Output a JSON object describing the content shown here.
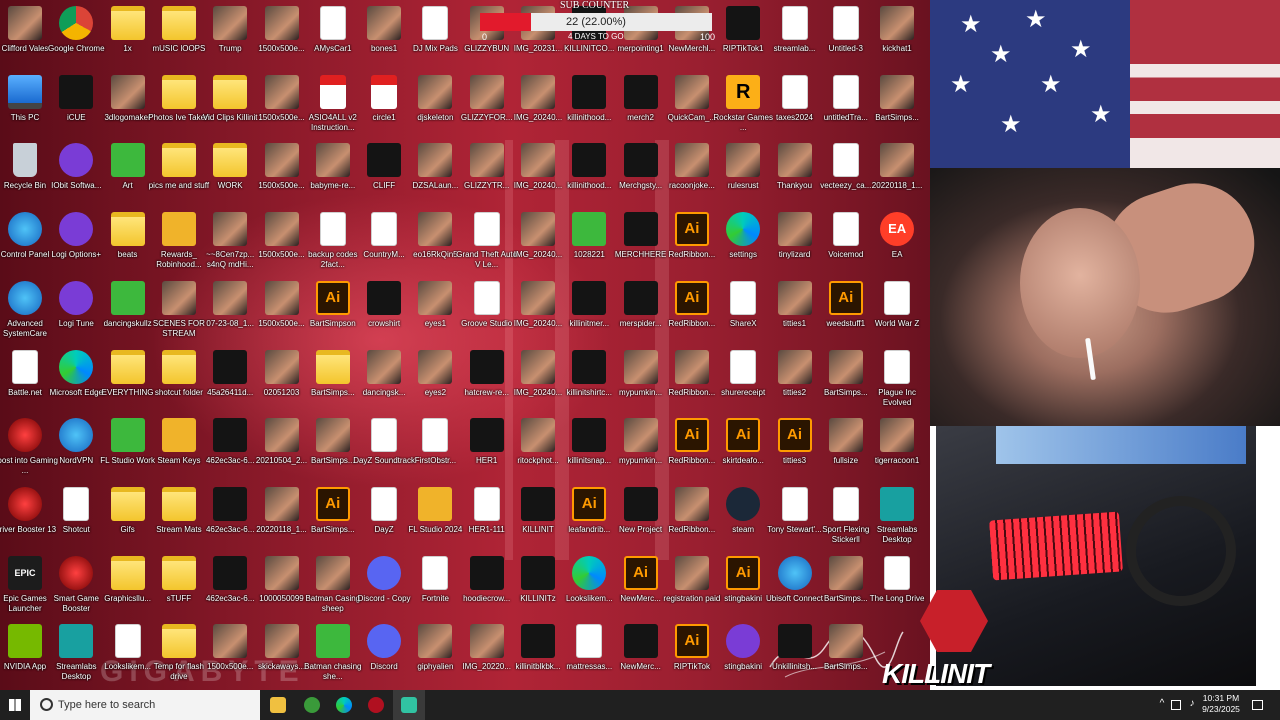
{
  "desktop": {
    "icons": [
      [
        "Clifford Vales",
        "img"
      ],
      [
        "Google Chrome",
        "chrome"
      ],
      [
        "1x",
        "folder"
      ],
      [
        "mUSIC lOOPS",
        "folder"
      ],
      [
        "Trump",
        "img"
      ],
      [
        "1500x500e...",
        "img"
      ],
      [
        "AMysCar1",
        "doc"
      ],
      [
        "bones1",
        "img"
      ],
      [
        "DJ Mix Pads",
        "doc"
      ],
      [
        "GLIZZYBUN",
        "img"
      ],
      [
        "IMG_20231...",
        "img"
      ],
      [
        "KILLINITCO...",
        "dark"
      ],
      [
        "merpointing1",
        "img"
      ],
      [
        "NewMerchl...",
        "img"
      ],
      [
        "RIPTikTok1",
        "dark"
      ],
      [
        "streamlab...",
        "doc"
      ],
      [
        "Untitled-3",
        "doc"
      ],
      [
        "kickhat1",
        "img"
      ],
      [
        "New",
        "doc"
      ],
      [
        "This PC",
        "pc"
      ],
      [
        "iCUE",
        "dark"
      ],
      [
        "3dlogomaker",
        "img"
      ],
      [
        "Photos Ive Taken",
        "folder"
      ],
      [
        "Vid Clips Killinit",
        "folder"
      ],
      [
        "1500x500e...",
        "img"
      ],
      [
        "ASIO4ALL v2 Instruction...",
        "pdf"
      ],
      [
        "circle1",
        "pdf"
      ],
      [
        "djskeleton",
        "img"
      ],
      [
        "GLIZZYFOR...",
        "img"
      ],
      [
        "IMG_20240...",
        "img"
      ],
      [
        "killinithood...",
        "dark"
      ],
      [
        "merch2",
        "dark"
      ],
      [
        "QuickCam_...",
        "img"
      ],
      [
        "Rockstar Games ...",
        "r"
      ],
      [
        "taxes2024",
        "doc"
      ],
      [
        "untitledTra...",
        "doc"
      ],
      [
        "BartSimps...",
        "img"
      ],
      [
        "Recycle Bin",
        "bin"
      ],
      [
        "IObit Softwa...",
        "purple"
      ],
      [
        "Art",
        "green"
      ],
      [
        "pics me and stuff",
        "folder"
      ],
      [
        "WORK",
        "folder"
      ],
      [
        "1500x500e...",
        "img"
      ],
      [
        "babyme-re...",
        "img"
      ],
      [
        "CLIFF",
        "dark"
      ],
      [
        "DZSALaun...",
        "img"
      ],
      [
        "GLIZZYTR...",
        "img"
      ],
      [
        "IMG_20240...",
        "img"
      ],
      [
        "killinithood...",
        "dark"
      ],
      [
        "Merchgsty...",
        "dark"
      ],
      [
        "racoonjoke...",
        "img"
      ],
      [
        "rulesrust",
        "img"
      ],
      [
        "Thankyou",
        "img"
      ],
      [
        "vecteezy_ca...",
        "doc"
      ],
      [
        "20220118_1...",
        "img"
      ],
      [
        "Control Panel",
        "app"
      ],
      [
        "Logi Options+",
        "purple"
      ],
      [
        "beats",
        "folder"
      ],
      [
        "Rewards_ Robinhood...",
        "gold"
      ],
      [
        "~~8Cen7zp... s4nQ mdHi...",
        "img"
      ],
      [
        "1500x500e...",
        "img"
      ],
      [
        "backup codes 2fact...",
        "doc"
      ],
      [
        "CountryM...",
        "doc"
      ],
      [
        "eo16RkQin5",
        "img"
      ],
      [
        "Grand Theft Auto V Le...",
        "doc"
      ],
      [
        "IMG_20240...",
        "img"
      ],
      [
        "1028221",
        "green"
      ],
      [
        "MERCHHERE",
        "dark"
      ],
      [
        "RedRibbon...",
        "ai"
      ],
      [
        "settings",
        "edge"
      ],
      [
        "tinylizard",
        "img"
      ],
      [
        "Voicemod",
        "doc"
      ],
      [
        "EA",
        "ea"
      ],
      [
        "Advanced SystemCare",
        "app"
      ],
      [
        "Logi Tune",
        "purple"
      ],
      [
        "dancingskullz",
        "green"
      ],
      [
        "SCENES FOR STREAM",
        "img"
      ],
      [
        "07-23-08_1...",
        "img"
      ],
      [
        "1500x500e...",
        "img"
      ],
      [
        "BartSimpson",
        "ai"
      ],
      [
        "crowshirt",
        "dark"
      ],
      [
        "eyes1",
        "img"
      ],
      [
        "Groove Studio",
        "doc"
      ],
      [
        "IMG_20240...",
        "img"
      ],
      [
        "killinitmer...",
        "dark"
      ],
      [
        "merspider...",
        "dark"
      ],
      [
        "RedRibbon...",
        "ai"
      ],
      [
        "ShareX",
        "doc"
      ],
      [
        "titties1",
        "img"
      ],
      [
        "weedstuff1",
        "ai"
      ],
      [
        "World War Z",
        "doc"
      ],
      [
        "Battle.net",
        "doc"
      ],
      [
        "Microsoft Edge",
        "edge"
      ],
      [
        "EVERYTHING",
        "folder"
      ],
      [
        "shotcut folder",
        "folder"
      ],
      [
        "45a26411d...",
        "dark"
      ],
      [
        "02051203",
        "img"
      ],
      [
        "BartSimps...",
        "folder"
      ],
      [
        "dancingsk...",
        "img"
      ],
      [
        "eyes2",
        "img"
      ],
      [
        "hatcrew-re...",
        "dark"
      ],
      [
        "IMG_20240...",
        "img"
      ],
      [
        "killinitshirtc...",
        "dark"
      ],
      [
        "mypumkin...",
        "img"
      ],
      [
        "RedRibbon...",
        "img"
      ],
      [
        "shurereceipt",
        "doc"
      ],
      [
        "titties2",
        "img"
      ],
      [
        "BartSimps...",
        "img"
      ],
      [
        "Plague Inc Evolved",
        "doc"
      ],
      [
        "Boost into Gaming ...",
        "red"
      ],
      [
        "NordVPN",
        "app"
      ],
      [
        "FL Studio Work",
        "green"
      ],
      [
        "Steam Keys",
        "gold"
      ],
      [
        "462ec3ac-6...",
        "dark"
      ],
      [
        "20210504_2...",
        "img"
      ],
      [
        "BartSimps...",
        "img"
      ],
      [
        "DayZ Soundtrack",
        "doc"
      ],
      [
        "FirstObstr...",
        "doc"
      ],
      [
        "HER1",
        "dark"
      ],
      [
        "ritockphot...",
        "img"
      ],
      [
        "killinitsnap...",
        "dark"
      ],
      [
        "mypumkin...",
        "img"
      ],
      [
        "RedRibbon...",
        "ai"
      ],
      [
        "skirtdeafo...",
        "ai"
      ],
      [
        "titties3",
        "ai"
      ],
      [
        "fullsize",
        "img"
      ],
      [
        "tigerracoon1",
        "img"
      ],
      [
        "Driver Booster 13",
        "red"
      ],
      [
        "Shotcut",
        "doc"
      ],
      [
        "Gifs",
        "folder"
      ],
      [
        "Stream Mats",
        "folder"
      ],
      [
        "462ec3ac-6...",
        "dark"
      ],
      [
        "20220118_1...",
        "img"
      ],
      [
        "BartSimps...",
        "ai"
      ],
      [
        "DayZ",
        "doc"
      ],
      [
        "FL Studio 2024",
        "gold"
      ],
      [
        "HER1-111",
        "doc"
      ],
      [
        "KILLINIT",
        "dark"
      ],
      [
        "leafandrib...",
        "ai"
      ],
      [
        "New Project",
        "dark"
      ],
      [
        "RedRibbon...",
        "img"
      ],
      [
        "steam",
        "steam"
      ],
      [
        "Tony Stewart'...",
        "doc"
      ],
      [
        "Sport Flexing Stickerll",
        "doc"
      ],
      [
        "Streamlabs Desktop",
        "teal"
      ],
      [
        "Epic Games Launcher",
        "epic"
      ],
      [
        "Smart Game Booster",
        "red"
      ],
      [
        "Graphicsllu...",
        "folder"
      ],
      [
        "sTUFF",
        "folder"
      ],
      [
        "462ec3ac-6...",
        "dark"
      ],
      [
        "1000050099",
        "img"
      ],
      [
        "Batman Casing sheep",
        "img"
      ],
      [
        "Discord - Copy",
        "discord"
      ],
      [
        "Fortnite",
        "doc"
      ],
      [
        "hoodiecrow...",
        "dark"
      ],
      [
        "KILLINITz",
        "dark"
      ],
      [
        "Lookslikem...",
        "edge"
      ],
      [
        "NewMerc...",
        "ai"
      ],
      [
        "registration paid",
        "img"
      ],
      [
        "stingbakini",
        "ai"
      ],
      [
        "Ubisoft Connect",
        "app"
      ],
      [
        "BartSimps...",
        "img"
      ],
      [
        "The Long Drive",
        "doc"
      ],
      [
        "NVIDIA App",
        "nvidia"
      ],
      [
        "Streamlabs Desktop",
        "teal"
      ],
      [
        "Lookslikem...",
        "doc"
      ],
      [
        "Temp for flash drive",
        "folder"
      ],
      [
        "1500x500e...",
        "img"
      ],
      [
        "skickaways...",
        "img"
      ],
      [
        "Batman chasing she...",
        "green"
      ],
      [
        "Discord",
        "discord"
      ],
      [
        "giphyalien",
        "img"
      ],
      [
        "IMG_20220...",
        "img"
      ],
      [
        "killinitblkbk...",
        "dark"
      ],
      [
        "mattressas...",
        "doc"
      ],
      [
        "NewMerc...",
        "dark"
      ],
      [
        "RIPTikTok",
        "ai"
      ],
      [
        "stingbakini",
        "purple"
      ],
      [
        "Unkillinitsh...",
        "dark"
      ],
      [
        "BartSimps...",
        "img"
      ]
    ],
    "watermark": "GIGABYTE"
  },
  "sub_counter": {
    "title": "SUB COUNTER",
    "count_text": "22 (22.00%)",
    "progress": 0.22,
    "min": "0",
    "max": "100",
    "days": "4 DAYS TO GO"
  },
  "overlay": {
    "logo_text": "KILLINIT"
  },
  "taskbar": {
    "search_placeholder": "Type here to search",
    "time": "10:31 PM",
    "date": "9/23/2025"
  }
}
